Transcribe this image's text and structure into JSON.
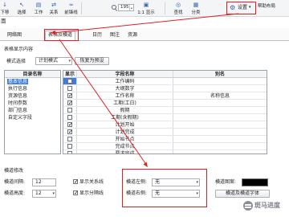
{
  "ribbon": {
    "items": [
      {
        "label": "下移",
        "icon": "move-down-icon"
      },
      {
        "label": "选择",
        "icon": "select-icon"
      },
      {
        "label": "工作",
        "icon": "task-icon"
      },
      {
        "label": "关系",
        "icon": "relation-icon"
      },
      {
        "label": "前锋线",
        "icon": "frontline-icon"
      }
    ],
    "zoom_value": "195",
    "fit_label": "1:1 显示",
    "find_label": "查找",
    "classify_label": "分类",
    "settings_label": "设置",
    "help_label": "帮助布局"
  },
  "dialog": {
    "title": "面",
    "tabs": [
      {
        "label": "网络图",
        "active": false
      },
      {
        "label": "表格及横道",
        "active": true
      },
      {
        "label": "日历",
        "active": false
      },
      {
        "label": "图注",
        "active": false
      },
      {
        "label": "资源",
        "active": false
      }
    ],
    "table_section": {
      "title": "表格显示内容",
      "mode_label": "模式选择",
      "mode_value": "计划模式",
      "reset_label": "恢复为预设"
    },
    "catalog": {
      "header": "目录名称",
      "items": [
        "基本信息",
        "执行信息",
        "资源信息",
        "时间参数",
        "部门信息",
        "自定义字段"
      ],
      "selected_index": 0
    },
    "fields": {
      "columns": [
        "显示",
        "字段名称",
        "别名"
      ],
      "selected_row": 0,
      "rows": [
        {
          "checked": false,
          "field": "工作编码",
          "alias": ""
        },
        {
          "checked": false,
          "field": "大纲数字",
          "alias": ""
        },
        {
          "checked": true,
          "field": "工作名称",
          "alias": "名称信息"
        },
        {
          "checked": true,
          "field": "工期(工日)",
          "alias": ""
        },
        {
          "checked": false,
          "field": "假期",
          "alias": ""
        },
        {
          "checked": false,
          "field": "工期(含假期)",
          "alias": ""
        },
        {
          "checked": true,
          "field": "计划开始",
          "alias": ""
        },
        {
          "checked": true,
          "field": "计划完成",
          "alias": ""
        },
        {
          "checked": false,
          "field": "开始节点",
          "alias": ""
        },
        {
          "checked": false,
          "field": "完成节点",
          "alias": ""
        },
        {
          "checked": false,
          "field": "要求完成",
          "alias": ""
        }
      ]
    },
    "bar_section": {
      "title": "横道修改",
      "spacing_label": "横道间隔:",
      "spacing_value": "12",
      "height_label": "横道高度:",
      "height_value": "12",
      "show_relation_label": "显示关系线",
      "show_relation_checked": true,
      "show_divider_label": "显示分隔线",
      "show_divider_checked": true,
      "left_label": "横道左侧:",
      "left_value": "无",
      "right_label": "横道右侧:",
      "right_value": "无",
      "pattern_label": "横道图案:",
      "pattern_color": "#000000",
      "font_button_label": "横道及横道字体"
    }
  },
  "watermark": {
    "text": "斑马进度"
  },
  "colors": {
    "annotation_red": "#e02020",
    "selection_blue": "#3b7dd8",
    "ribbon_icon": "#2f66b3"
  }
}
